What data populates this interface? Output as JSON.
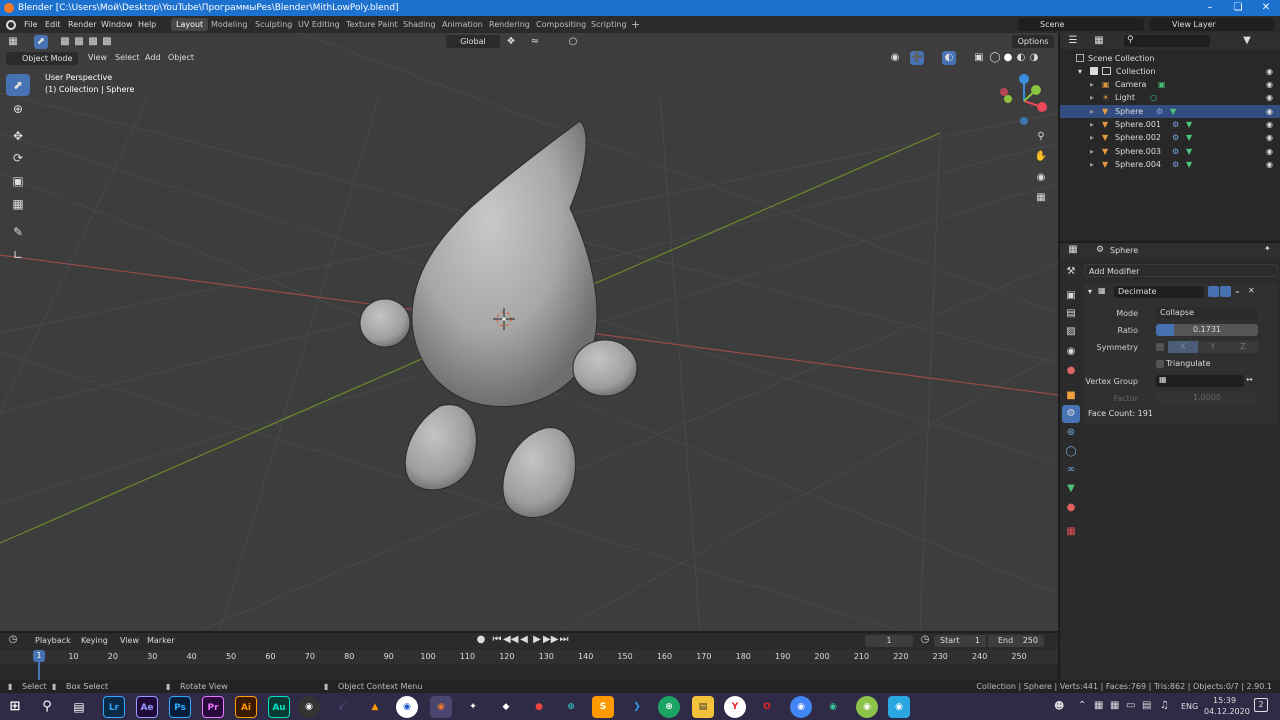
{
  "window": {
    "title": "Blender [C:\\Users\\Мой\\Desktop\\YouTube\\ПрограммыPes\\Blender\\MithLowPoly.blend]"
  },
  "menu": {
    "items": [
      "File",
      "Edit",
      "Render",
      "Window",
      "Help"
    ]
  },
  "workspaces": [
    "Layout",
    "Modeling",
    "Sculpting",
    "UV Editing",
    "Texture Paint",
    "Shading",
    "Animation",
    "Rendering",
    "Compositing",
    "Scripting"
  ],
  "top_right": {
    "scene": "Scene",
    "view_layer": "View Layer"
  },
  "viewport": {
    "mode": "Object Mode",
    "menus": [
      "View",
      "Select",
      "Add",
      "Object"
    ],
    "transform": "Global",
    "options": "Options",
    "overlay_title": "User Perspective",
    "overlay_sub": "(1) Collection | Sphere",
    "gizmo": {
      "x": "X",
      "y": "Y",
      "z": "Z"
    }
  },
  "outliner": {
    "root": "Scene Collection",
    "collection": "Collection",
    "items": [
      {
        "name": "Camera",
        "type": "camera"
      },
      {
        "name": "Light",
        "type": "light"
      },
      {
        "name": "Sphere",
        "type": "mesh"
      },
      {
        "name": "Sphere.001",
        "type": "mesh"
      },
      {
        "name": "Sphere.002",
        "type": "mesh"
      },
      {
        "name": "Sphere.003",
        "type": "mesh"
      },
      {
        "name": "Sphere.004",
        "type": "mesh"
      }
    ]
  },
  "properties": {
    "object": "Sphere",
    "add_modifier": "Add Modifier",
    "modifier_name": "Decimate",
    "mode_label": "Mode",
    "mode_value": "Collapse",
    "ratio_label": "Ratio",
    "ratio_value": "0.1731",
    "ratio_fraction": 0.1731,
    "symmetry_label": "Symmetry",
    "axes": [
      "X",
      "Y",
      "Z"
    ],
    "triangulate": "Triangulate",
    "vertex_group": "Vertex Group",
    "factor_label": "Factor",
    "factor_value": "1.0000",
    "face_count": "Face Count: 191"
  },
  "timeline": {
    "menus": [
      "Playback",
      "Keying",
      "View",
      "Marker"
    ],
    "current_frame": "1",
    "start_label": "Start",
    "start": "1",
    "end_label": "End",
    "end": "250",
    "ticks": [
      "1",
      "10",
      "20",
      "30",
      "40",
      "50",
      "60",
      "70",
      "80",
      "90",
      "100",
      "110",
      "120",
      "130",
      "140",
      "150",
      "160",
      "170",
      "180",
      "190",
      "200",
      "210",
      "220",
      "230",
      "240",
      "250"
    ]
  },
  "status": {
    "select": "Select",
    "box_select": "Box Select",
    "rotate": "Rotate View",
    "context": "Object Context Menu",
    "stats": "Collection | Sphere | Verts:441 | Faces:769 | Tris:862 | Objects:0/7 | 2.90.1"
  },
  "taskbar": {
    "apps": [
      {
        "label": "Lr",
        "color": "#0a2a47",
        "fg": "#31a8ff"
      },
      {
        "label": "Ae",
        "color": "#1f0a3a",
        "fg": "#9999ff"
      },
      {
        "label": "Ps",
        "color": "#061e3a",
        "fg": "#31a8ff"
      },
      {
        "label": "Pr",
        "color": "#2a0a3a",
        "fg": "#ea77ff"
      },
      {
        "label": "Ai",
        "color": "#3a1a00",
        "fg": "#ff9a00"
      },
      {
        "label": "Au",
        "color": "#0a3a34",
        "fg": "#00e4bb"
      }
    ],
    "lang": "ENG",
    "time": "15:39",
    "date": "04.12.2020",
    "notif": "2"
  },
  "colors": {
    "accent": "#4772b3",
    "x_axis": "#e8485a",
    "y_axis": "#8bc540",
    "z_axis": "#3b8fde",
    "titlebar": "#1e72cf",
    "taskbar": "#2f2a46"
  }
}
